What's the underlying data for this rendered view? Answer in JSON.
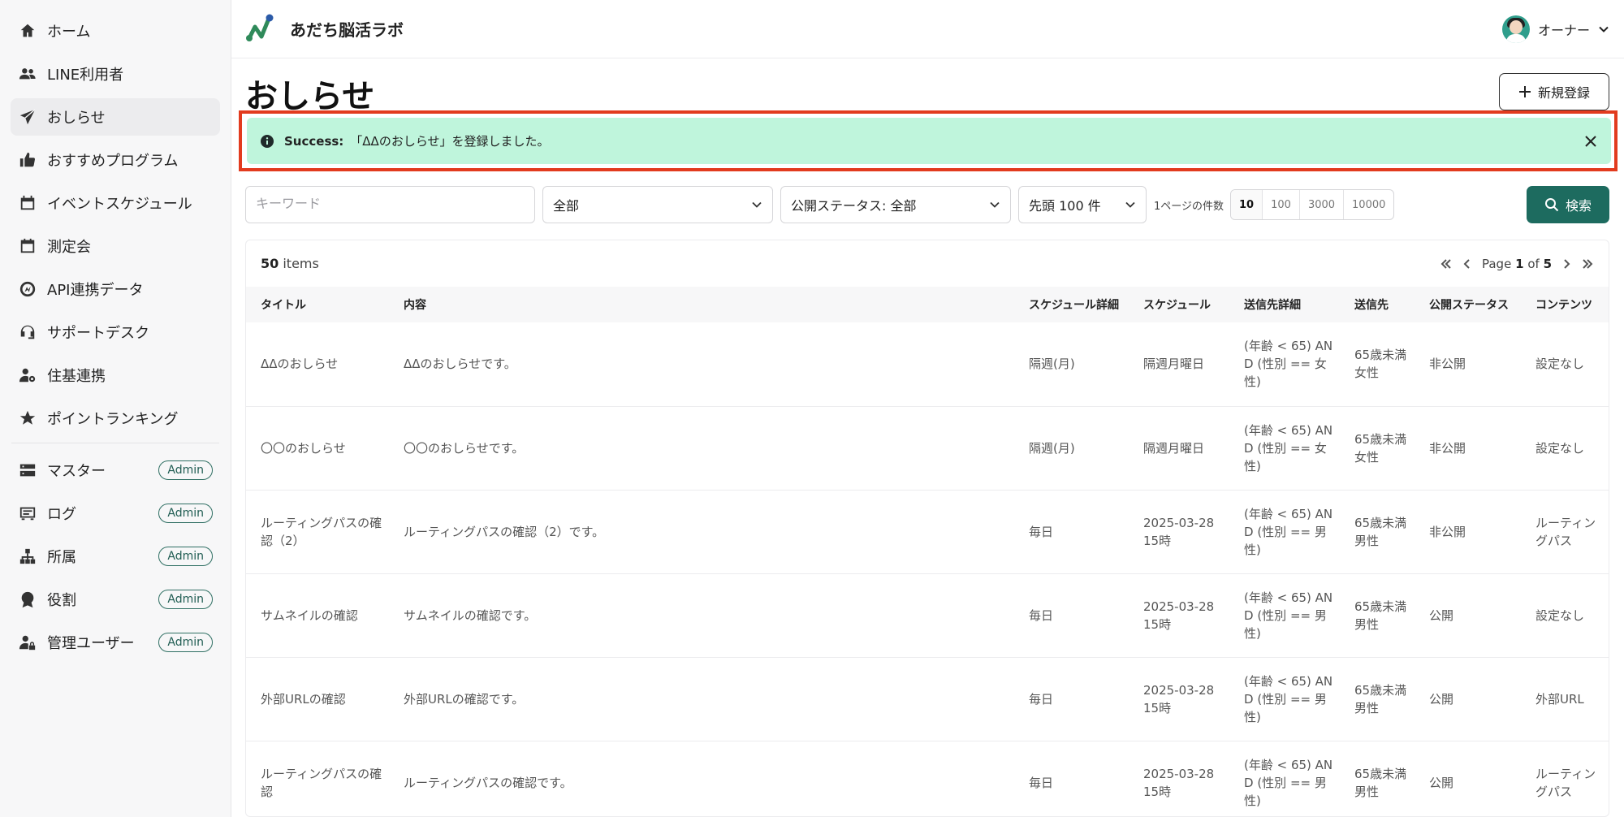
{
  "app": {
    "title": "あだち脳活ラボ"
  },
  "colors": {
    "accent": "#1d6b5f",
    "alert_bg": "#bff5dc",
    "highlight": "#e23b1e"
  },
  "sidebar": {
    "items": [
      {
        "label": "ホーム",
        "icon": "home-icon"
      },
      {
        "label": "LINE利用者",
        "icon": "users-icon"
      },
      {
        "label": "おしらせ",
        "icon": "paper-plane-icon"
      },
      {
        "label": "おすすめプログラム",
        "icon": "thumbs-up-icon"
      },
      {
        "label": "イベントスケジュール",
        "icon": "calendar-icon"
      },
      {
        "label": "測定会",
        "icon": "calendar-blank-icon"
      },
      {
        "label": "API連携データ",
        "icon": "api-icon"
      },
      {
        "label": "サポートデスク",
        "icon": "headset-icon"
      },
      {
        "label": "住基連携",
        "icon": "user-gear-icon"
      },
      {
        "label": "ポイントランキング",
        "icon": "star-icon"
      }
    ],
    "admin_items": [
      {
        "label": "マスター",
        "badge": "Admin",
        "icon": "server-icon"
      },
      {
        "label": "ログ",
        "badge": "Admin",
        "icon": "log-icon"
      },
      {
        "label": "所属",
        "badge": "Admin",
        "icon": "org-chart-icon"
      },
      {
        "label": "役割",
        "badge": "Admin",
        "icon": "medal-icon"
      },
      {
        "label": "管理ユーザー",
        "badge": "Admin",
        "icon": "user-lock-icon"
      }
    ]
  },
  "header": {
    "user_label": "オーナー"
  },
  "page": {
    "title": "おしらせ",
    "new_button": "新規登録"
  },
  "alert": {
    "prefix": "Success:",
    "message": "「ΔΔのおしらせ」を登録しました。"
  },
  "filters": {
    "keyword_placeholder": "キーワード",
    "category": "全部",
    "status": "公開ステータス: 全部",
    "limit": "先頭 100 件",
    "per_page_label": "1ページの件数",
    "per_page_options": [
      "10",
      "100",
      "3000",
      "10000"
    ],
    "per_page_selected": "10",
    "search_button": "検索"
  },
  "table": {
    "count": "50",
    "count_suffix": "items",
    "page_prefix": "Page",
    "page_current": "1",
    "page_of": "of",
    "page_total": "5",
    "columns": [
      "タイトル",
      "内容",
      "スケジュール詳細",
      "スケジュール",
      "送信先詳細",
      "送信先",
      "公開ステータス",
      "コンテンツ"
    ],
    "rows": [
      [
        "ΔΔのおしらせ",
        "ΔΔのおしらせです。",
        "隔週(月)",
        "隔週月曜日",
        "(年齢 < 65) AND (性別 == 女性)",
        "65歳未満女性",
        "非公開",
        "設定なし"
      ],
      [
        "〇〇のおしらせ",
        "〇〇のおしらせです。",
        "隔週(月)",
        "隔週月曜日",
        "(年齢 < 65) AND (性別 == 女性)",
        "65歳未満女性",
        "非公開",
        "設定なし"
      ],
      [
        "ルーティングパスの確認（2）",
        "ルーティングパスの確認（2）です。",
        "毎日",
        "2025-03-28 15時",
        "(年齢 < 65) AND (性別 == 男性)",
        "65歳未満男性",
        "非公開",
        "ルーティングパス"
      ],
      [
        "サムネイルの確認",
        "サムネイルの確認です。",
        "毎日",
        "2025-03-28 15時",
        "(年齢 < 65) AND (性別 == 男性)",
        "65歳未満男性",
        "公開",
        "設定なし"
      ],
      [
        "外部URLの確認",
        "外部URLの確認です。",
        "毎日",
        "2025-03-28 15時",
        "(年齢 < 65) AND (性別 == 男性)",
        "65歳未満男性",
        "公開",
        "外部URL"
      ],
      [
        "ルーティングパスの確認",
        "ルーティングパスの確認です。",
        "毎日",
        "2025-03-28 15時",
        "(年齢 < 65) AND (性別 == 男性)",
        "65歳未満男性",
        "公開",
        "ルーティングパス"
      ]
    ]
  }
}
